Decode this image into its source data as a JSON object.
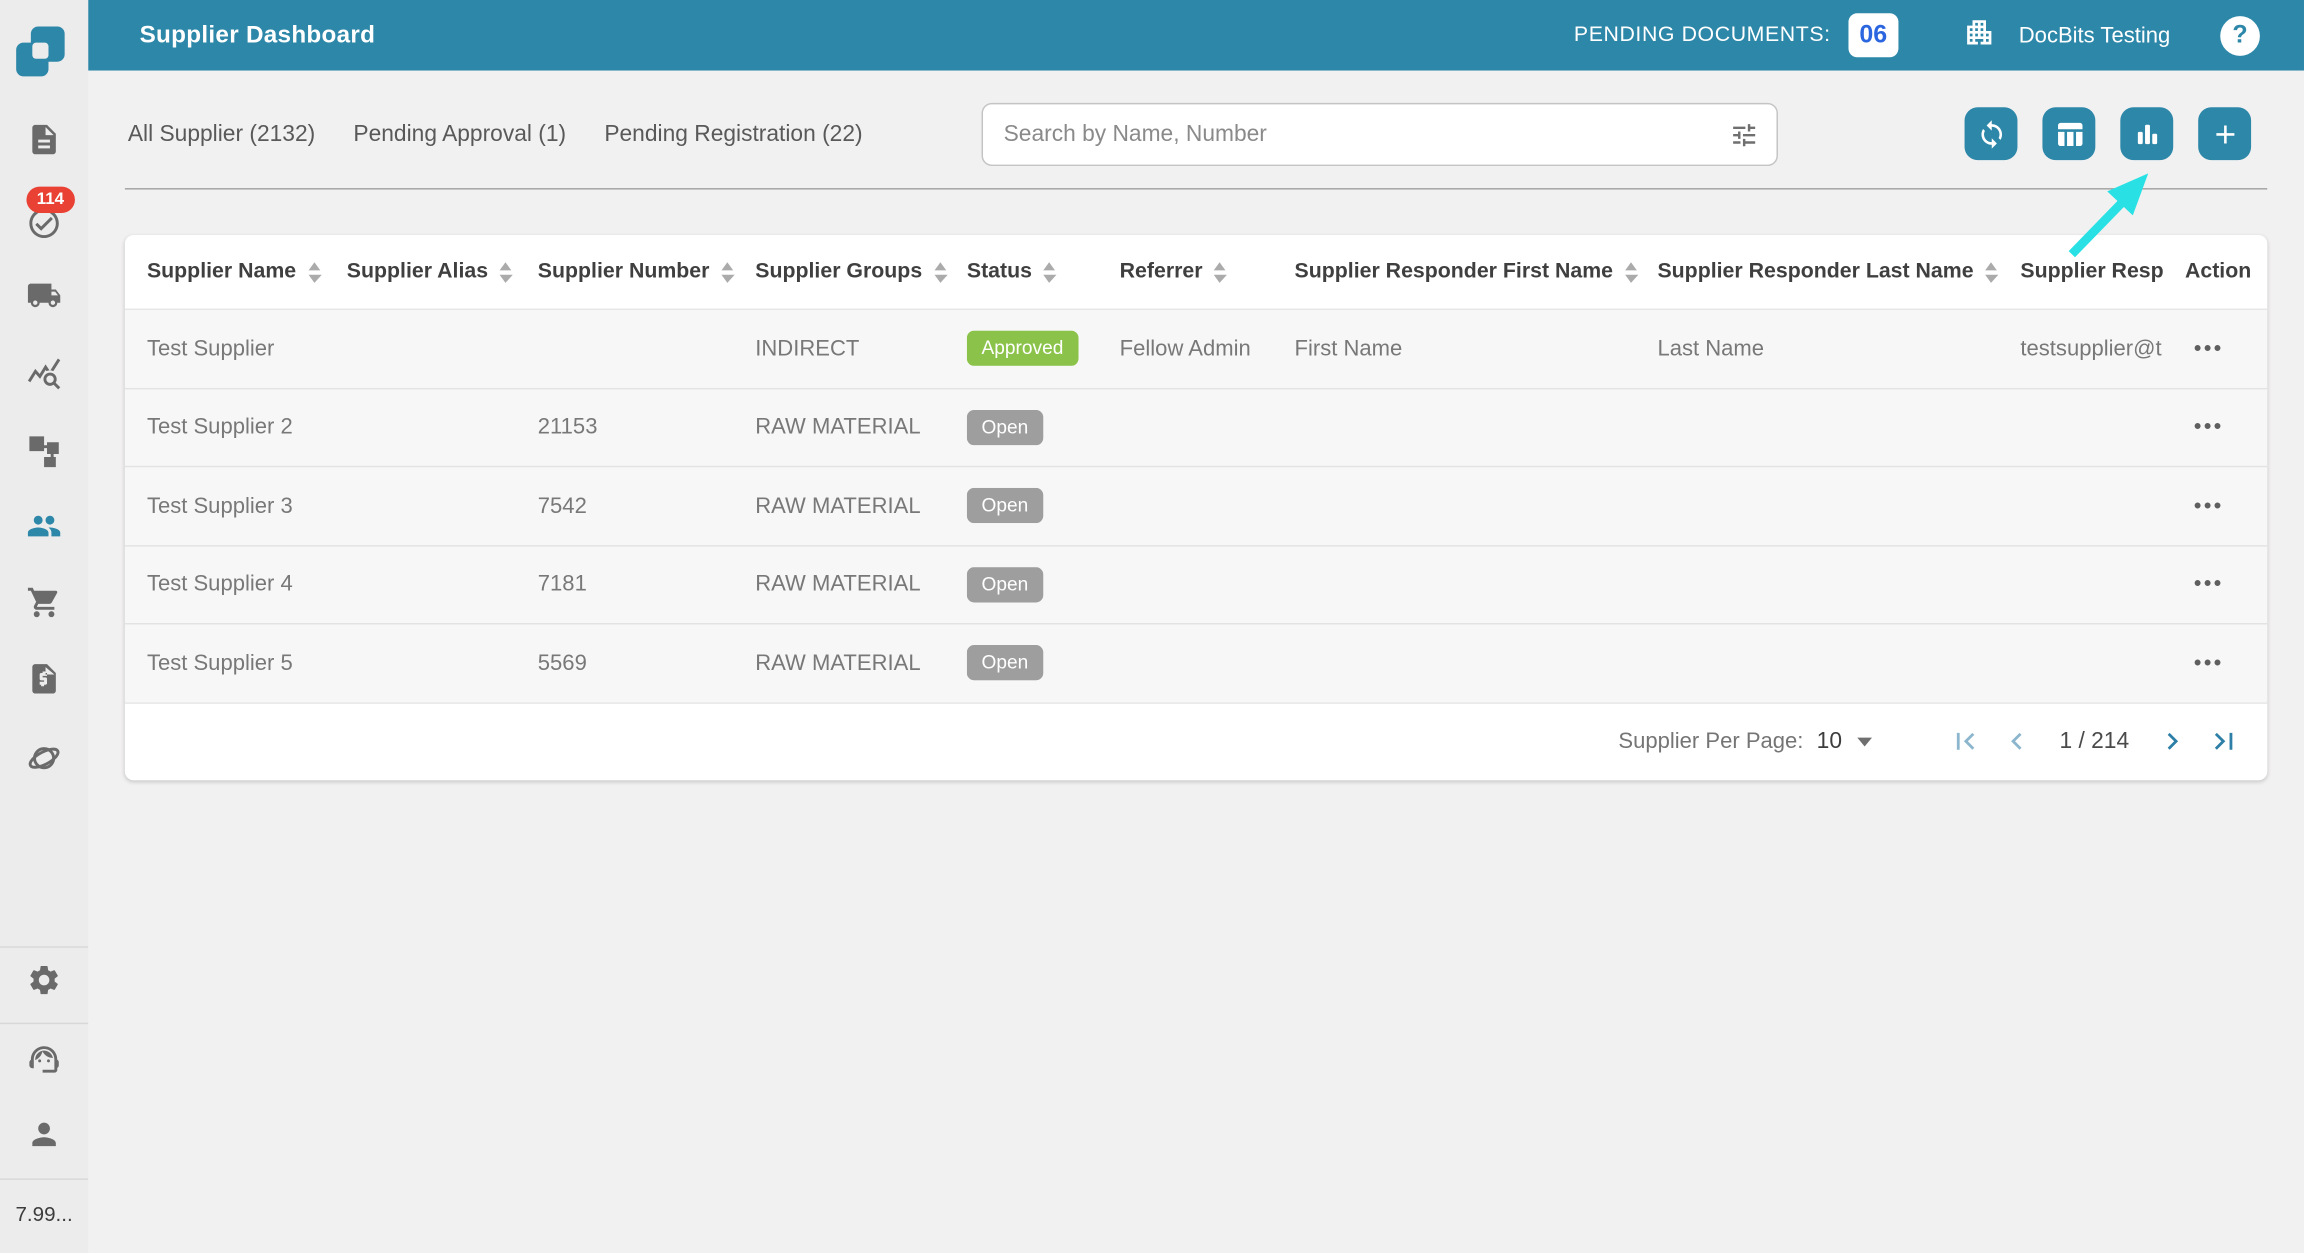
{
  "header": {
    "title": "Supplier Dashboard",
    "pending_documents_label": "PENDING DOCUMENTS:",
    "pending_documents_count": "06",
    "org_name": "DocBits Testing",
    "help_glyph": "?"
  },
  "sidebar": {
    "items": [
      {
        "name": "sidebar-item-documents",
        "icon": "document-icon"
      },
      {
        "name": "sidebar-item-approvals",
        "icon": "check-circle-icon",
        "badge": "114"
      },
      {
        "name": "sidebar-item-shipments",
        "icon": "truck-icon"
      },
      {
        "name": "sidebar-item-analytics",
        "icon": "query-stats-icon"
      },
      {
        "name": "sidebar-item-workflows",
        "icon": "schema-icon"
      },
      {
        "name": "sidebar-item-suppliers",
        "icon": "people-icon",
        "active": true
      },
      {
        "name": "sidebar-item-purchase-orders",
        "icon": "cart-icon"
      },
      {
        "name": "sidebar-item-invoices",
        "icon": "invoice-icon"
      },
      {
        "name": "sidebar-item-integrations",
        "icon": "orbit-icon"
      }
    ],
    "bottom_items": [
      {
        "name": "sidebar-item-settings",
        "icon": "gear-icon"
      },
      {
        "name": "sidebar-item-support",
        "icon": "headset-icon"
      },
      {
        "name": "sidebar-item-profile",
        "icon": "person-icon"
      }
    ],
    "notification_count": "114",
    "usage_text": "7.99..."
  },
  "tabs": [
    {
      "name": "tab-all-supplier",
      "label": "All Supplier (2132)"
    },
    {
      "name": "tab-pending-approval",
      "label": "Pending Approval (1)"
    },
    {
      "name": "tab-pending-registration",
      "label": "Pending Registration (22)"
    }
  ],
  "search": {
    "placeholder": "Search by Name, Number"
  },
  "toolbar": {
    "buttons": [
      {
        "name": "refresh-button",
        "icon": "sync-icon"
      },
      {
        "name": "column-settings-button",
        "icon": "table-columns-icon"
      },
      {
        "name": "chart-view-button",
        "icon": "bar-chart-icon"
      },
      {
        "name": "add-supplier-button",
        "icon": "plus-icon"
      }
    ]
  },
  "table": {
    "columns": [
      {
        "id": "name",
        "label": "Supplier Name",
        "sortable": true
      },
      {
        "id": "alias",
        "label": "Supplier Alias",
        "sortable": true
      },
      {
        "id": "number",
        "label": "Supplier Number",
        "sortable": true
      },
      {
        "id": "groups",
        "label": "Supplier Groups",
        "sortable": true
      },
      {
        "id": "status",
        "label": "Status",
        "sortable": true
      },
      {
        "id": "referrer",
        "label": "Referrer",
        "sortable": true
      },
      {
        "id": "responder_first_name",
        "label": "Supplier Responder First Name",
        "sortable": true
      },
      {
        "id": "responder_last_name",
        "label": "Supplier Responder Last Name",
        "sortable": true
      },
      {
        "id": "responder_email",
        "label": "Supplier Resp",
        "sortable": false
      },
      {
        "id": "action",
        "label": "Action",
        "sortable": false
      }
    ],
    "action_glyph": "•••",
    "rows": [
      {
        "name": "Test Supplier",
        "alias": "",
        "number": "",
        "groups": "INDIRECT",
        "status": "Approved",
        "status_type": "approved",
        "referrer": "Fellow Admin",
        "responder_first_name": "First Name",
        "responder_last_name": "Last Name",
        "responder_email": "testsupplier@t"
      },
      {
        "name": "Test Supplier 2",
        "alias": "",
        "number": "21153",
        "groups": "RAW MATERIAL",
        "status": "Open",
        "status_type": "open",
        "referrer": "",
        "responder_first_name": "",
        "responder_last_name": "",
        "responder_email": ""
      },
      {
        "name": "Test Supplier 3",
        "alias": "",
        "number": "7542",
        "groups": "RAW MATERIAL",
        "status": "Open",
        "status_type": "open",
        "referrer": "",
        "responder_first_name": "",
        "responder_last_name": "",
        "responder_email": ""
      },
      {
        "name": "Test Supplier 4",
        "alias": "",
        "number": "7181",
        "groups": "RAW MATERIAL",
        "status": "Open",
        "status_type": "open",
        "referrer": "",
        "responder_first_name": "",
        "responder_last_name": "",
        "responder_email": ""
      },
      {
        "name": "Test Supplier 5",
        "alias": "",
        "number": "5569",
        "groups": "RAW MATERIAL",
        "status": "Open",
        "status_type": "open",
        "referrer": "",
        "responder_first_name": "",
        "responder_last_name": "",
        "responder_email": ""
      }
    ]
  },
  "pagination": {
    "per_page_label": "Supplier Per Page:",
    "per_page_value": "10",
    "page_indicator": "1 / 214",
    "controls": [
      {
        "name": "first-page-button",
        "icon": "first-page-icon",
        "disabled": true
      },
      {
        "name": "previous-page-button",
        "icon": "chevron-left-icon",
        "disabled": true
      },
      {
        "name": "next-page-button",
        "icon": "chevron-right-icon",
        "disabled": false
      },
      {
        "name": "last-page-button",
        "icon": "last-page-icon",
        "disabled": false
      }
    ]
  },
  "colors": {
    "accent_teal": "#2d87a9",
    "notification_red": "#e94235",
    "count_blue": "#2b66e0",
    "status_approved": "#8bc34a",
    "status_open": "#9e9e9e",
    "annotation_arrow_cyan": "#29e1e4",
    "pager_enabled": "#2d7fa8",
    "pager_disabled": "#8cb6cd",
    "icon_gray": "#6a6a6a"
  }
}
